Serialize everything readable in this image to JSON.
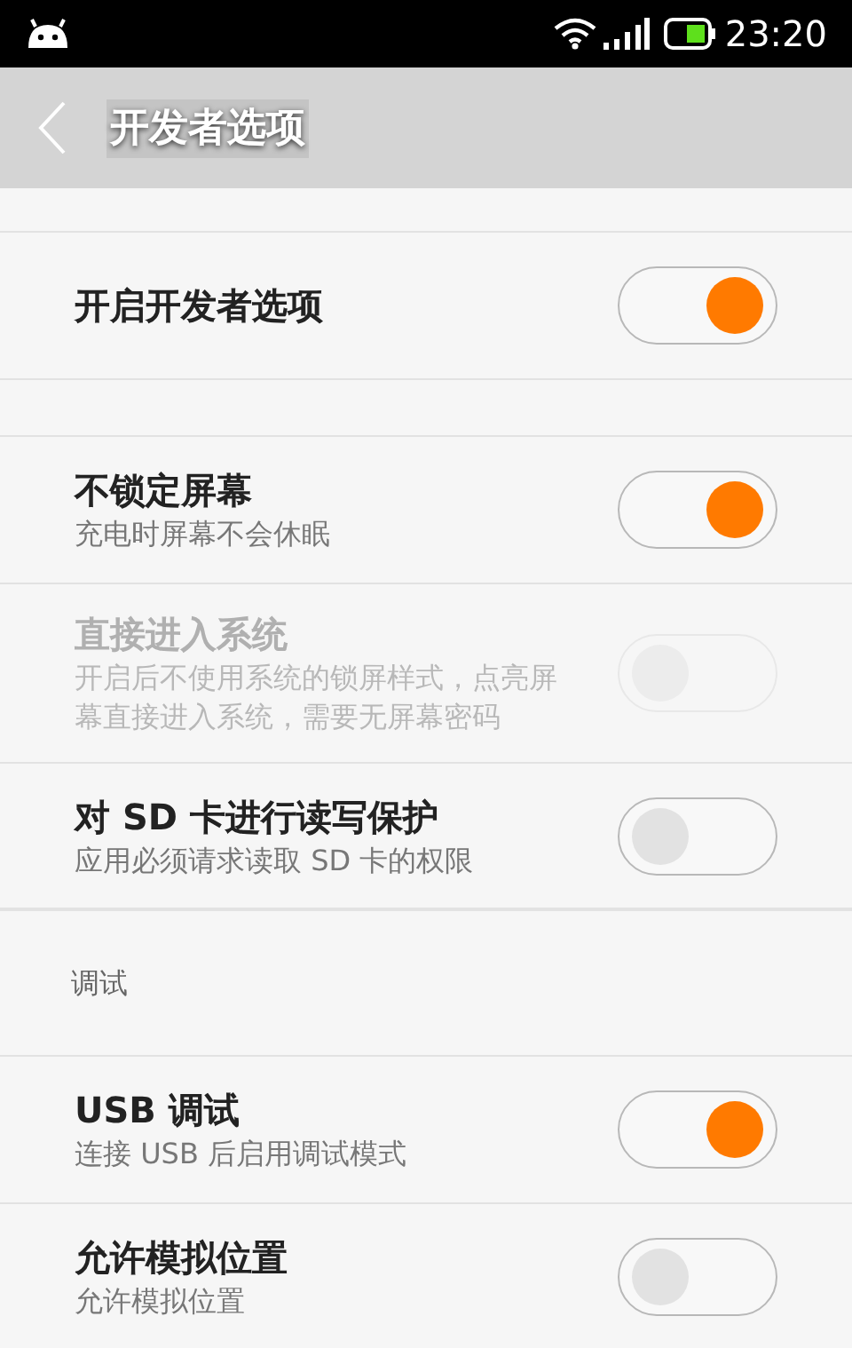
{
  "status_bar": {
    "time": "23:20"
  },
  "header": {
    "title": "开发者选项"
  },
  "sections": [
    {
      "items": [
        {
          "title": "开启开发者选项",
          "on": true,
          "disabled": false
        }
      ]
    },
    {
      "items": [
        {
          "title": "不锁定屏幕",
          "subtitle": "充电时屏幕不会休眠",
          "on": true,
          "disabled": false
        },
        {
          "title": "直接进入系统",
          "subtitle": "开启后不使用系统的锁屏样式，点亮屏幕直接进入系统，需要无屏幕密码",
          "on": false,
          "disabled": true
        },
        {
          "title": "对 SD 卡进行读写保护",
          "subtitle": "应用必须请求读取 SD 卡的权限",
          "on": false,
          "disabled": false
        }
      ]
    },
    {
      "title": "调试",
      "items": [
        {
          "title": "USB 调试",
          "subtitle": "连接 USB 后启用调试模式",
          "on": true,
          "disabled": false
        },
        {
          "title": "允许模拟位置",
          "subtitle": "允许模拟位置",
          "on": false,
          "disabled": false
        }
      ]
    }
  ]
}
